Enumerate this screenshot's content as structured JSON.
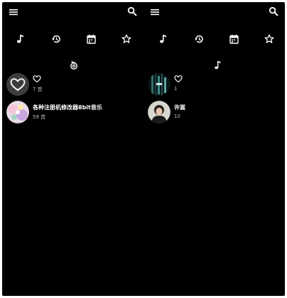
{
  "colors": {
    "background": "#000000",
    "foreground": "#ffffff",
    "secondary_text": "#bdbdbd"
  },
  "left_pane": {
    "toolbar_icons": [
      "menu-icon",
      "search-icon"
    ],
    "tabs": [
      {
        "icon": "music-note-icon"
      },
      {
        "icon": "history-icon"
      },
      {
        "icon": "calendar-icon"
      },
      {
        "icon": "star-icon"
      }
    ],
    "section_icon": "hashtag-spiral-icon",
    "playlists": [
      {
        "title_icon": "heart-icon",
        "count": "7 首"
      },
      {
        "title": "各种注册机修改器8bit音乐",
        "count": "59 首"
      }
    ]
  },
  "right_pane": {
    "toolbar_icons": [
      "menu-icon",
      "search-icon"
    ],
    "tabs": [
      {
        "icon": "music-note-icon"
      },
      {
        "icon": "history-icon"
      },
      {
        "icon": "calendar-icon"
      },
      {
        "icon": "star-icon"
      }
    ],
    "section_icon": "music-note-icon",
    "playlists": [
      {
        "title_icon": "heart-icon",
        "count": "1"
      },
      {
        "title": "许嵩",
        "count": "10"
      }
    ]
  }
}
